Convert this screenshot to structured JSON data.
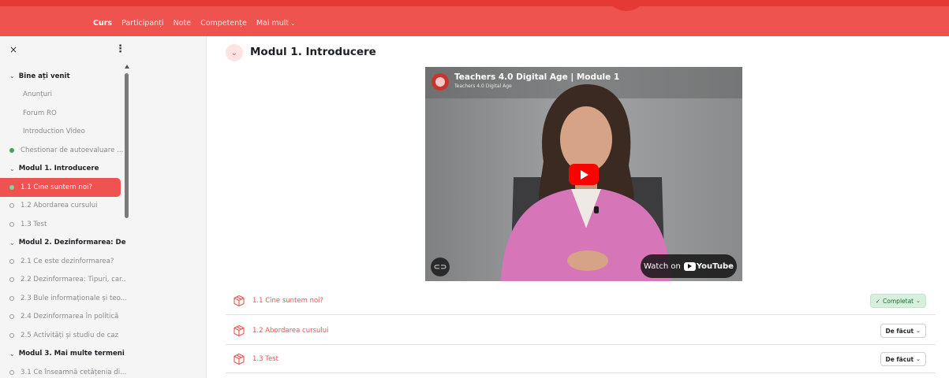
{
  "nav": {
    "items": [
      {
        "label": "Curs",
        "active": true
      },
      {
        "label": "Participanți",
        "active": false
      },
      {
        "label": "Note",
        "active": false
      },
      {
        "label": "Competențe",
        "active": false
      },
      {
        "label": "Mai mult",
        "active": false
      }
    ]
  },
  "sidebar": {
    "close_glyph": "×",
    "menu_glyph": "⋮",
    "items": [
      {
        "kind": "section",
        "label": "Bine ați venit"
      },
      {
        "kind": "plain",
        "label": "Anunțuri"
      },
      {
        "kind": "plain",
        "label": "Forum RO"
      },
      {
        "kind": "plain",
        "label": "Introduction Video"
      },
      {
        "kind": "activity",
        "status": "done",
        "label": "Chestionar de autoevaluare ..."
      },
      {
        "kind": "section",
        "label": "Modul 1. Introducere"
      },
      {
        "kind": "activity",
        "status": "done",
        "label": "1.1 Cine suntem noi?",
        "current": true
      },
      {
        "kind": "activity",
        "status": "todo",
        "label": "1.2 Abordarea cursului"
      },
      {
        "kind": "activity",
        "status": "todo",
        "label": "1.3 Test"
      },
      {
        "kind": "section",
        "label": "Modul 2. Dezinformarea: De..."
      },
      {
        "kind": "activity",
        "status": "todo",
        "label": "2.1 Ce este dezinformarea?"
      },
      {
        "kind": "activity",
        "status": "todo",
        "label": "2.2 Dezinformarea: Tipuri, car..."
      },
      {
        "kind": "activity",
        "status": "todo",
        "label": "2.3 Bule informaționale și teo..."
      },
      {
        "kind": "activity",
        "status": "todo",
        "label": "2.4 Dezinformarea în politică"
      },
      {
        "kind": "activity",
        "status": "todo",
        "label": "2.5 Activități și studiu de caz"
      },
      {
        "kind": "section",
        "label": "Modul 3. Mai multe termeni ..."
      },
      {
        "kind": "activity",
        "status": "todo",
        "label": "3.1 Ce înseamnă cetățenia di..."
      }
    ]
  },
  "main": {
    "section_title": "Modul 1. Introducere",
    "video": {
      "title": "Teachers 4.0 Digital Age | Module 1",
      "channel": "Teachers 4.0 Digital Age",
      "watch_label": "Watch on",
      "youtube_label": "YouTube"
    },
    "activities": [
      {
        "label": "1.1 Cine suntem noi?",
        "button": "Completat",
        "state": "done"
      },
      {
        "label": "1.2 Abordarea cursului",
        "button": "De făcut",
        "state": "todo"
      },
      {
        "label": "1.3 Test",
        "button": "De făcut",
        "state": "todo"
      }
    ]
  },
  "colors": {
    "brand_red": "#ef5350",
    "done_green": "#3aa65a",
    "done_button_bg": "#d7efdc"
  }
}
